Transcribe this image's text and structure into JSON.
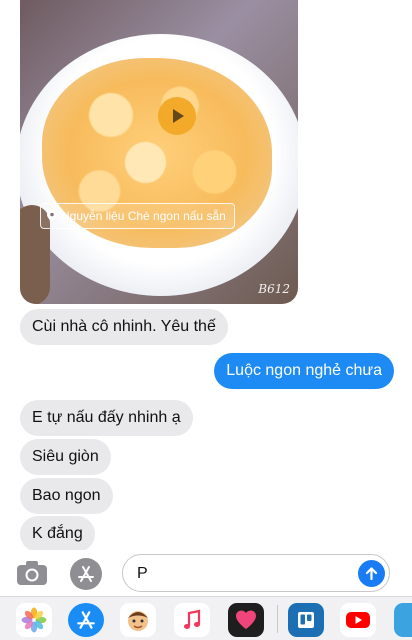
{
  "conversation": {
    "media": {
      "location_tag": "Nguyễn liệu Chè ngon nấu sẵn",
      "watermark": "B612",
      "play_icon": "play-icon",
      "pin_icon": "location-pin-icon"
    },
    "messages": [
      {
        "direction": "incoming",
        "text": "Cùi nhà cô nhinh. Yêu thế"
      },
      {
        "direction": "outgoing",
        "text": "Luộc ngon nghẻ chưa"
      },
      {
        "direction": "incoming",
        "text": "E tự nấu đấy nhinh ạ"
      },
      {
        "direction": "incoming",
        "text": "Siêu giòn"
      },
      {
        "direction": "incoming",
        "text": "Bao ngon"
      },
      {
        "direction": "incoming",
        "text": "K đắng"
      }
    ]
  },
  "composer": {
    "text_value": "P",
    "camera_icon": "camera-icon",
    "appstore_icon": "appstore-icon",
    "send_icon": "send-arrow-icon"
  },
  "app_drawer": {
    "apps": [
      {
        "name": "photos-app-icon",
        "color": "#ffffff"
      },
      {
        "name": "appstore-app-icon",
        "color": "#1a8cf5"
      },
      {
        "name": "memoji-app-icon",
        "color": "#ffffff"
      },
      {
        "name": "music-app-icon",
        "color": "#ffffff"
      },
      {
        "name": "heart-sticker-app-icon",
        "color": "#1e1e1e"
      },
      {
        "name": "trello-app-icon",
        "color": "#1d6fb3"
      },
      {
        "name": "youtube-app-icon",
        "color": "#ffffff"
      },
      {
        "name": "partial-app-icon",
        "color": "#3aa3e0"
      }
    ]
  },
  "colors": {
    "outgoing_bubble": "#1d8bf3",
    "incoming_bubble": "#e9e9eb",
    "send_button": "#1a7cf5"
  }
}
